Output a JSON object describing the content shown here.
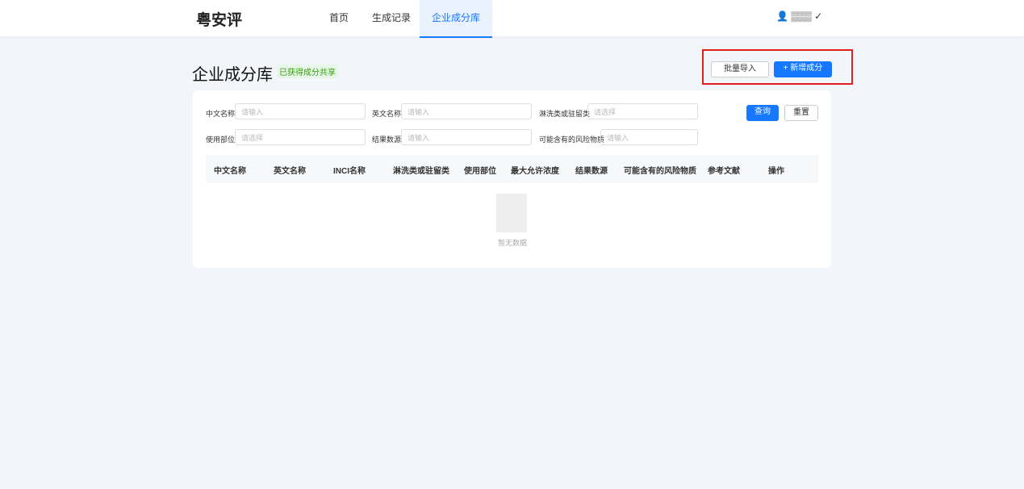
{
  "brand": "粤安评",
  "nav": [
    "首页",
    "生成记录",
    "企业成分库"
  ],
  "title": "企业成分库",
  "badge": "已获得成分共享",
  "import": "批量导入",
  "add": "+ 新增成分",
  "labels": [
    "中文名称",
    "英文名称",
    "淋洗类或驻留类",
    "使用部位",
    "结果数源",
    "可能含有的风险物质"
  ],
  "ph": [
    "请输入",
    "请输入",
    "请选择",
    "请选择",
    "请输入",
    "请输入"
  ],
  "query": "查询",
  "reset": "重置",
  "cols": [
    "中文名称",
    "英文名称",
    "INCI名称",
    "淋洗类或驻留类",
    "使用部位",
    "最大允许浓度",
    "结果数源",
    "可能含有的风险物质",
    "参考文献",
    "操作"
  ],
  "empty": "暂无数据"
}
